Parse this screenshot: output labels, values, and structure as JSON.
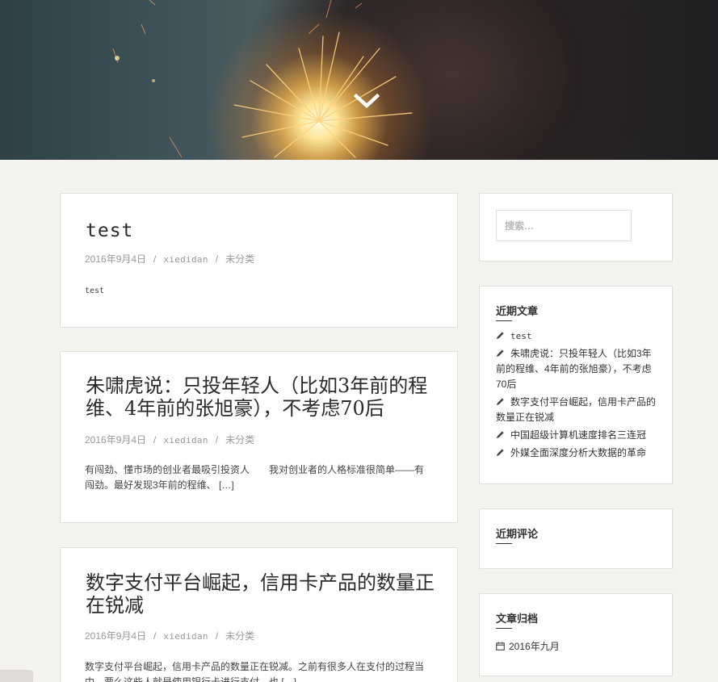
{
  "hero": {
    "scroll_icon": "chevron-down-icon"
  },
  "posts": [
    {
      "title": "test",
      "date": "2016年9月4日",
      "author": "xiedidan",
      "category": "未分类",
      "excerpt": "test"
    },
    {
      "title": "朱啸虎说：只投年轻人（比如3年前的程维、4年前的张旭豪），不考虑70后",
      "date": "2016年9月4日",
      "author": "xiedidan",
      "category": "未分类",
      "excerpt": "有闯劲、懂市场的创业者最吸引投资人　　我对创业者的人格标准很简单——有闯劲。最好发现3年前的程维、 […]"
    },
    {
      "title": "数字支付平台崛起，信用卡产品的数量正在锐减",
      "date": "2016年9月4日",
      "author": "xiedidan",
      "category": "未分类",
      "excerpt": "数字支付平台崛起，信用卡产品的数量正在锐减。之前有很多人在支付的过程当中，要么这些人就是使用银行卡进行支付，也 […]"
    }
  ],
  "meta_separator": "/",
  "sidebar": {
    "search_placeholder": "搜索…",
    "recent_posts": {
      "title": "近期文章",
      "items": [
        "test",
        "朱啸虎说：只投年轻人（比如3年前的程维、4年前的张旭豪），不考虑70后",
        "数字支付平台崛起，信用卡产品的数量正在锐减",
        "中国超级计算机速度排名三连冠",
        "外媒全面深度分析大数据的革命"
      ]
    },
    "recent_comments": {
      "title": "近期评论"
    },
    "archives": {
      "title": "文章归档",
      "items": [
        "2016年九月"
      ]
    }
  }
}
